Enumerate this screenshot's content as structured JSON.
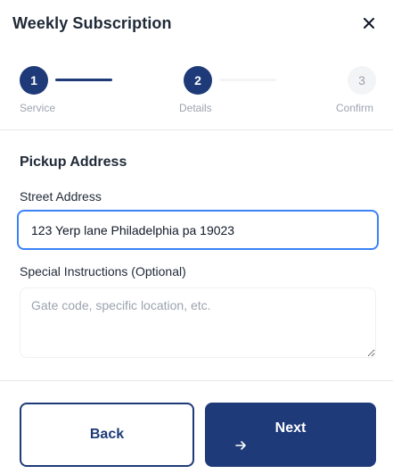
{
  "modal": {
    "title": "Weekly Subscription",
    "close_icon": "close-icon"
  },
  "stepper": {
    "current_step": 2,
    "steps": [
      {
        "number": "1",
        "label": "Service",
        "state": "completed"
      },
      {
        "number": "2",
        "label": "Details",
        "state": "active"
      },
      {
        "number": "3",
        "label": "Confirm",
        "state": "upcoming"
      }
    ]
  },
  "form": {
    "section_title": "Pickup Address",
    "street": {
      "label": "Street Address",
      "value": "123 Yerp lane Philadelphia pa 19023"
    },
    "instructions": {
      "label": "Special Instructions (Optional)",
      "value": "",
      "placeholder": "Gate code, specific location, etc."
    }
  },
  "footer": {
    "back_label": "Back",
    "next_label": "Next",
    "next_icon": "arrow-right-icon"
  },
  "colors": {
    "primary": "#1e3a78",
    "focus_border": "#3b82f6",
    "muted_text": "#9ca3af",
    "inactive_step": "#f3f4f6"
  }
}
